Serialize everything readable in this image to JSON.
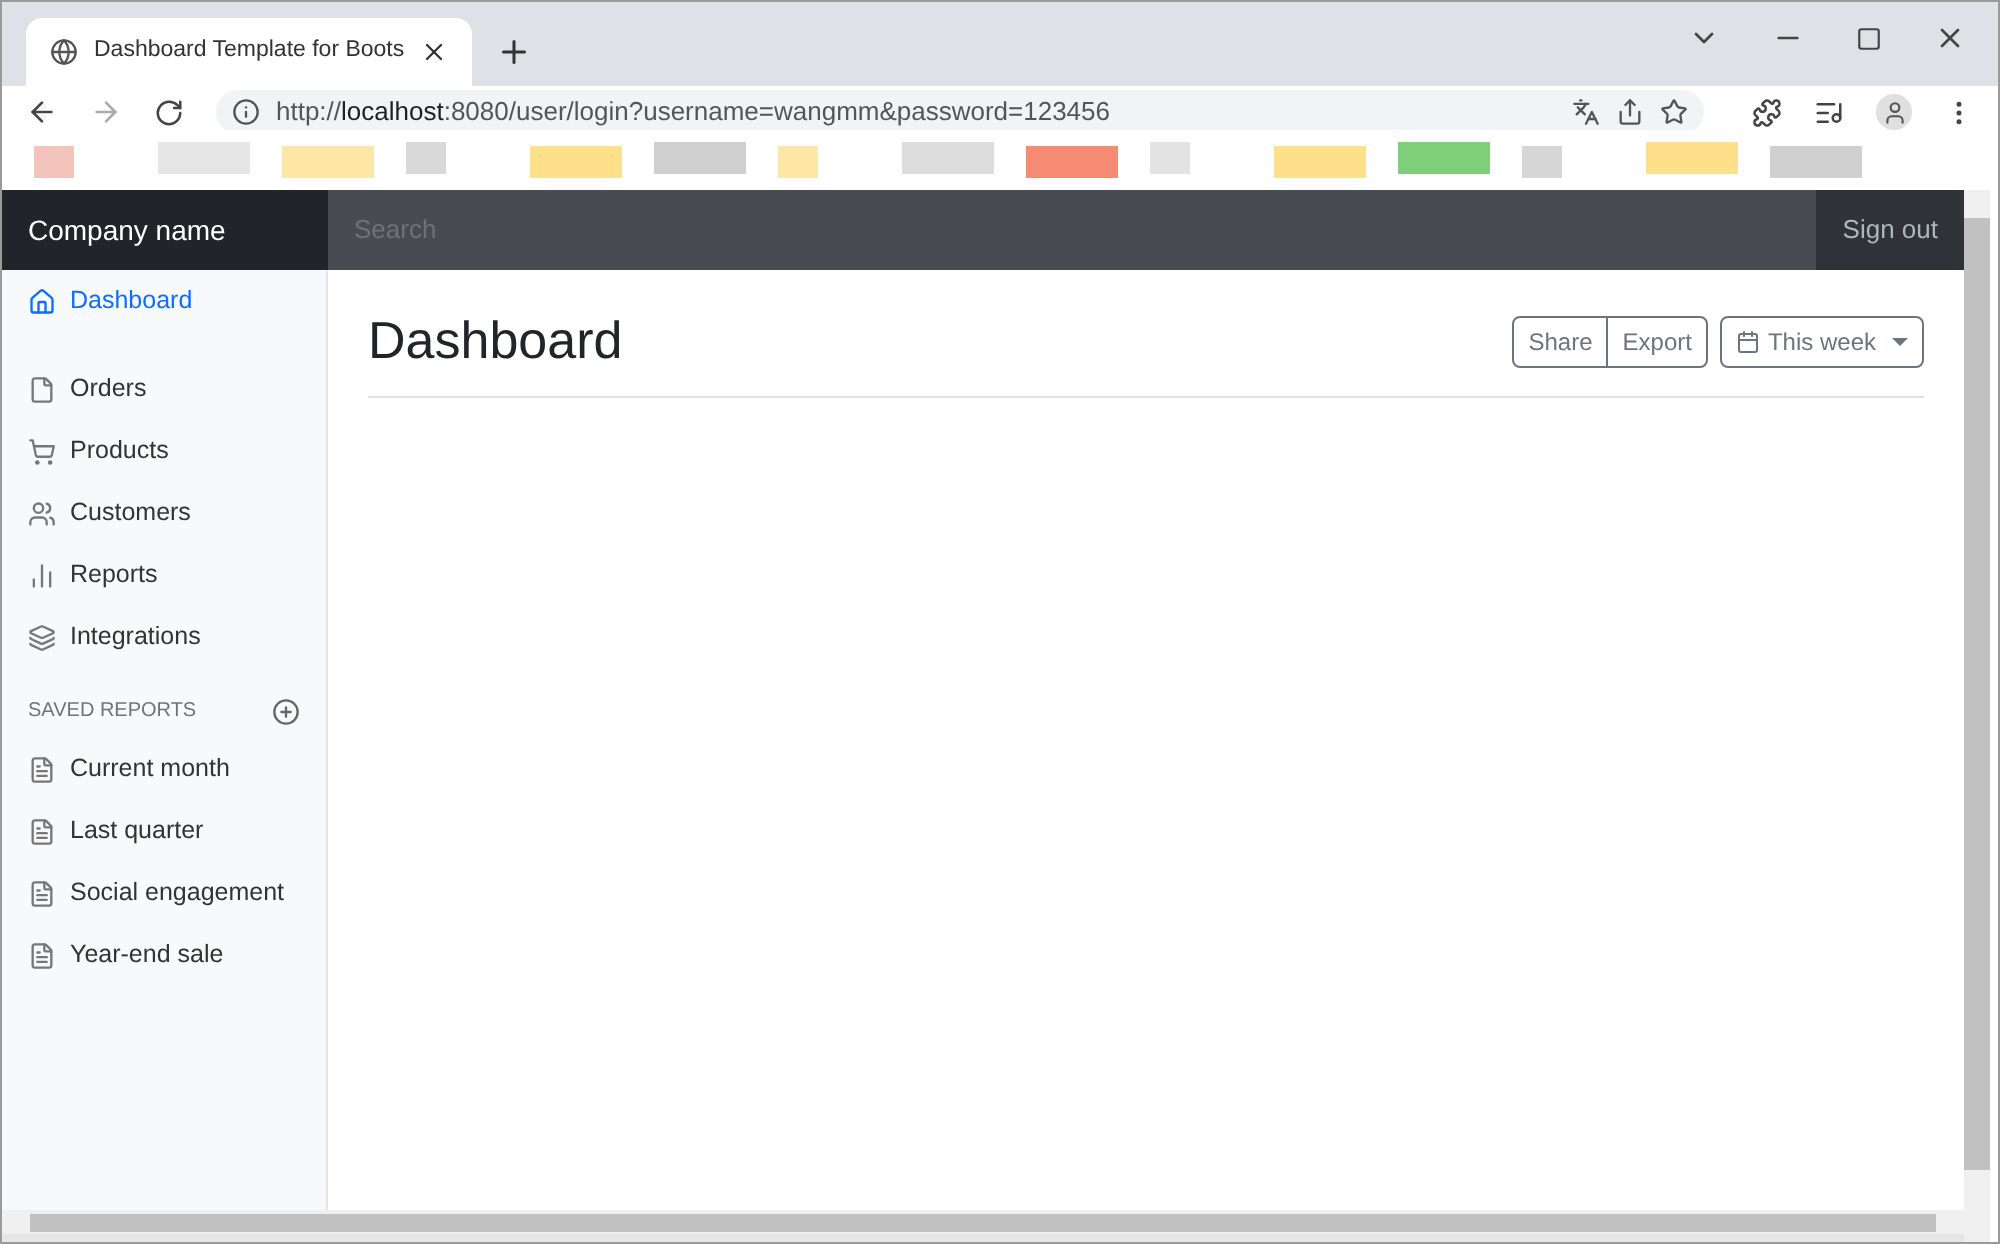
{
  "browser": {
    "tab_title": "Dashboard Template for Boots",
    "url_prefix": "http://",
    "url_host": "localhost",
    "url_rest": ":8080/user/login?username=wangmm&password=123456"
  },
  "navbar": {
    "brand": "Company name",
    "search_placeholder": "Search",
    "sign_out": "Sign out"
  },
  "sidebar": {
    "items": [
      {
        "label": "Dashboard",
        "selected": true
      },
      {
        "label": "Orders",
        "selected": false
      },
      {
        "label": "Products",
        "selected": false
      },
      {
        "label": "Customers",
        "selected": false
      },
      {
        "label": "Reports",
        "selected": false
      },
      {
        "label": "Integrations",
        "selected": false
      }
    ],
    "saved_heading": "SAVED REPORTS",
    "saved_items": [
      {
        "label": "Current month"
      },
      {
        "label": "Last quarter"
      },
      {
        "label": "Social engagement"
      },
      {
        "label": "Year-end sale"
      }
    ]
  },
  "main": {
    "title": "Dashboard",
    "buttons": [
      "Share",
      "Export"
    ],
    "period": "This week"
  }
}
